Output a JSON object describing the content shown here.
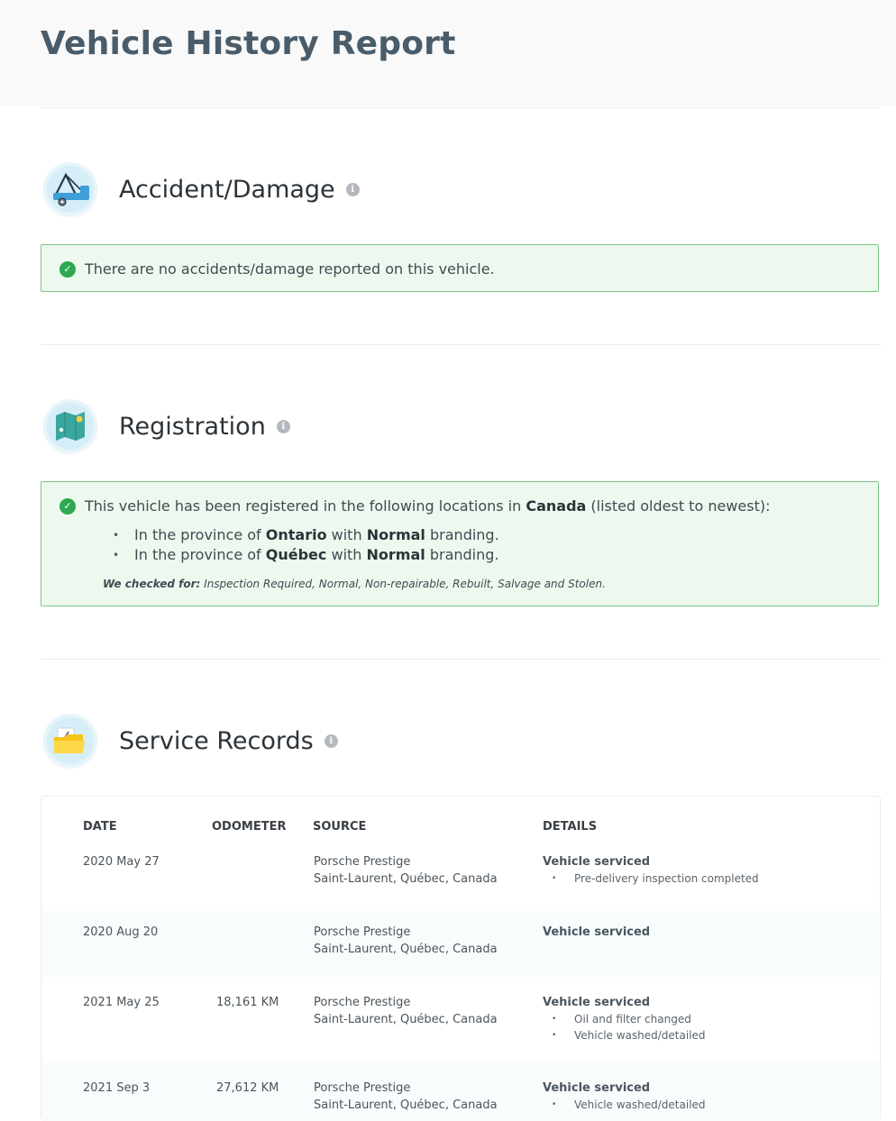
{
  "header": {
    "title": "Vehicle History Report"
  },
  "accident": {
    "title": "Accident/Damage",
    "icon": "tow-truck-icon",
    "message": "There are no accidents/damage reported on this vehicle."
  },
  "registration": {
    "title": "Registration",
    "icon": "map-icon",
    "intro_before": "This vehicle has been registered in the following locations in ",
    "country": "Canada",
    "intro_after": " (listed oldest to newest):",
    "items": [
      {
        "prefix": "In the province of ",
        "province": "Ontario",
        "mid": " with ",
        "branding": "Normal",
        "suffix": " branding."
      },
      {
        "prefix": "In the province of ",
        "province": "Québec",
        "mid": " with ",
        "branding": "Normal",
        "suffix": " branding."
      }
    ],
    "checked_label": "We checked for:",
    "checked_list": " Inspection Required, Normal, Non-repairable, Rebuilt, Salvage and Stolen."
  },
  "service": {
    "title": "Service Records",
    "icon": "folder-wrench-icon",
    "columns": {
      "date": "DATE",
      "odometer": "ODOMETER",
      "source": "SOURCE",
      "details": "DETAILS"
    },
    "rows": [
      {
        "date": "2020 May 27",
        "odometer": "",
        "source1": "Porsche Prestige",
        "source2": "Saint-Laurent, Québec, Canada",
        "detail_title": "Vehicle serviced",
        "details": [
          "Pre-delivery inspection completed"
        ]
      },
      {
        "date": "2020 Aug 20",
        "odometer": "",
        "source1": "Porsche Prestige",
        "source2": "Saint-Laurent, Québec, Canada",
        "detail_title": "Vehicle serviced",
        "details": []
      },
      {
        "date": "2021 May 25",
        "odometer": "18,161 KM",
        "source1": "Porsche Prestige",
        "source2": "Saint-Laurent, Québec, Canada",
        "detail_title": "Vehicle serviced",
        "details": [
          "Oil and filter changed",
          "Vehicle washed/detailed"
        ]
      },
      {
        "date": "2021 Sep 3",
        "odometer": "27,612 KM",
        "source1": "Porsche Prestige",
        "source2": "Saint-Laurent, Québec, Canada",
        "detail_title": "Vehicle serviced",
        "details": [
          "Vehicle washed/detailed"
        ]
      }
    ]
  }
}
